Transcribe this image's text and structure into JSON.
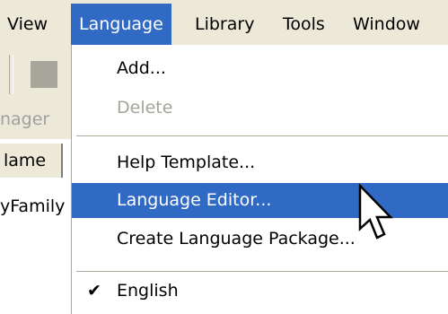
{
  "menubar": {
    "items": [
      "View",
      "Language",
      "Library",
      "Tools",
      "Window"
    ],
    "active": "Language"
  },
  "background": {
    "manager_label": "nager",
    "column_header": "lame",
    "row_text": "yFamily"
  },
  "language_menu": {
    "add": "Add...",
    "delete": "Delete",
    "help_template": "Help Template...",
    "language_editor": "Language Editor...",
    "create_package": "Create Language Package...",
    "english": "English",
    "english_check_icon": "checkmark-icon"
  },
  "colors": {
    "highlight": "#316ac5",
    "menubar_bg": "#ece9d8",
    "disabled_text": "#a6a497"
  }
}
